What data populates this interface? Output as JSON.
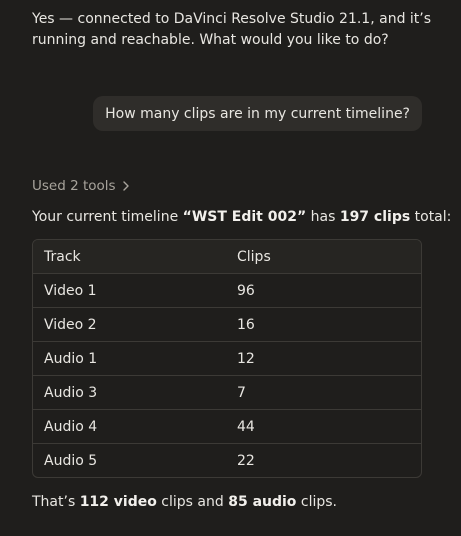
{
  "assistant_reply": "Yes — connected to DaVinci Resolve Studio 21.1, and it’s running and reachable. What would you like to do?",
  "user_message": "How many clips are in my current timeline?",
  "tools": {
    "label": "Used 2 tools",
    "icon": "chevron-right-icon"
  },
  "summary": {
    "prefix": "Your current timeline ",
    "timeline_name": "“WST Edit 002”",
    "middle": " has ",
    "clip_count": "197 clips",
    "suffix": " total:"
  },
  "table": {
    "headers": [
      "Track",
      "Clips"
    ],
    "rows": [
      {
        "track": "Video 1",
        "clips": "96"
      },
      {
        "track": "Video 2",
        "clips": "16"
      },
      {
        "track": "Audio 1",
        "clips": "12"
      },
      {
        "track": "Audio 3",
        "clips": "7"
      },
      {
        "track": "Audio 4",
        "clips": "44"
      },
      {
        "track": "Audio 5",
        "clips": "22"
      }
    ]
  },
  "final": {
    "prefix": "That’s ",
    "video_count": "112 video",
    "middle": " clips and ",
    "audio_count": "85 audio",
    "suffix": " clips."
  },
  "colors": {
    "background": "#1f1e1c",
    "bubble": "#2f2d2a",
    "muted_text": "#a8a49c",
    "border": "#3c3a36"
  }
}
